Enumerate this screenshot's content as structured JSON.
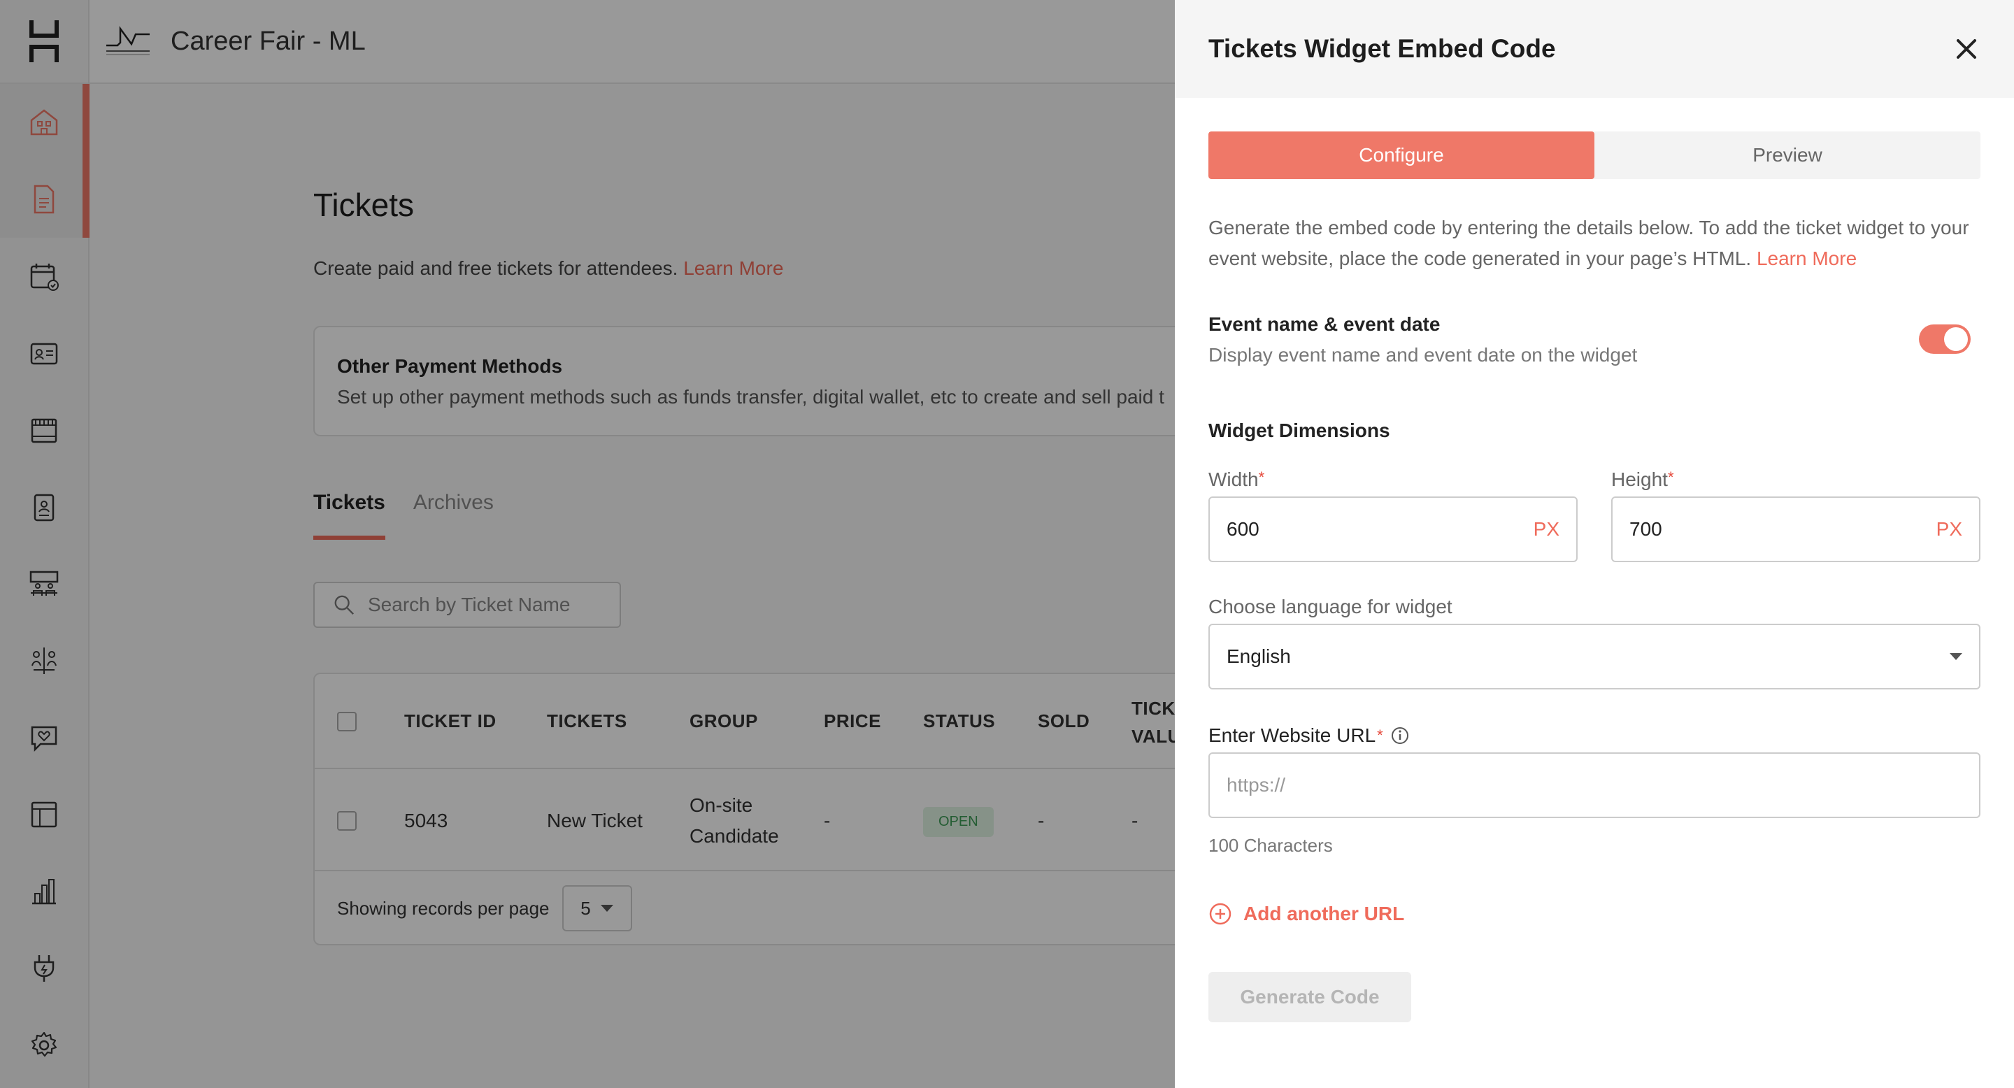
{
  "header": {
    "event_title": "Career Fair - ML"
  },
  "sidebar": {
    "items": [
      {
        "icon": "home-icon"
      },
      {
        "icon": "document-icon"
      },
      {
        "icon": "calendar-check-icon"
      },
      {
        "icon": "id-card-icon"
      },
      {
        "icon": "booth-icon"
      },
      {
        "icon": "badge-icon"
      },
      {
        "icon": "meeting-icon"
      },
      {
        "icon": "networking-icon"
      },
      {
        "icon": "chat-heart-icon"
      },
      {
        "icon": "layout-icon"
      },
      {
        "icon": "analytics-icon"
      },
      {
        "icon": "plug-icon"
      },
      {
        "icon": "gear-icon"
      }
    ]
  },
  "page": {
    "title": "Tickets",
    "subtitle": "Create paid and free tickets for attendees.",
    "learn_more": "Learn More",
    "card": {
      "title": "Other Payment Methods",
      "desc": "Set up other payment methods such as funds transfer, digital wallet, etc to create and sell paid t"
    },
    "tabs": [
      "Tickets",
      "Archives"
    ],
    "search_placeholder": "Search by Ticket Name",
    "table": {
      "columns": [
        "TICKET ID",
        "TICKETS",
        "GROUP",
        "PRICE",
        "STATUS",
        "SOLD",
        "TICK",
        "VALU"
      ],
      "rows": [
        {
          "id": "5043",
          "ticket": "New Ticket",
          "group_line1": "On-site",
          "group_line2": "Candidate",
          "price": "-",
          "status": "OPEN",
          "sold": "-",
          "value": "-"
        }
      ],
      "footer_label": "Showing records per page",
      "per_page": "5"
    }
  },
  "drawer": {
    "title": "Tickets Widget Embed Code",
    "tabs": [
      "Configure",
      "Preview"
    ],
    "description": "Generate the embed code by entering the details below. To add the ticket widget to your event website, place the code generated in your page’s HTML.",
    "learn_more": "Learn More",
    "event_toggle": {
      "label": "Event name & event date",
      "sub": "Display event name and event date on the widget",
      "on": true
    },
    "dimensions_label": "Widget Dimensions",
    "width": {
      "label": "Width",
      "value": "600",
      "unit": "PX"
    },
    "height": {
      "label": "Height",
      "value": "700",
      "unit": "PX"
    },
    "language": {
      "label": "Choose language for widget",
      "value": "English"
    },
    "url": {
      "label": "Enter Website URL",
      "placeholder": "https://",
      "help": "100 Characters"
    },
    "add_url": "Add another URL",
    "generate": "Generate Code",
    "colors": {
      "accent": "#ef7868"
    }
  }
}
